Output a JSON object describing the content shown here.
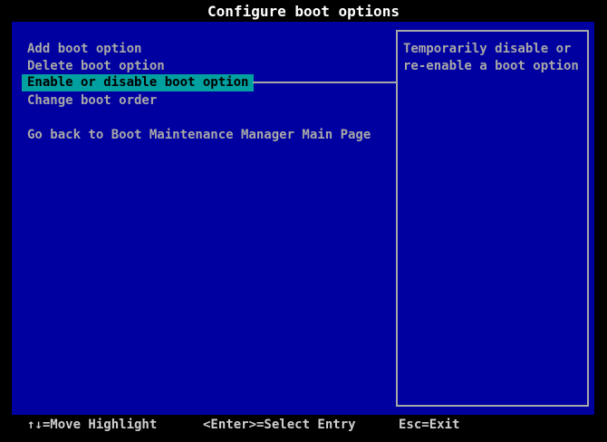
{
  "title": "Configure boot options",
  "colors": {
    "screen_background": "#000000",
    "panel_blue": "#0000A0",
    "menu_text_gray": "#A8A8A8",
    "highlight_background": "#00A0A0",
    "highlight_text": "#000000",
    "title_text": "#FFFFFF",
    "footer_text": "#D0D0D0",
    "help_border_gray": "#A8A8A8"
  },
  "menu": {
    "items": [
      {
        "label": "Add boot option",
        "selected": false
      },
      {
        "label": "Delete boot option",
        "selected": false
      },
      {
        "label": "Enable or disable boot option",
        "selected": true
      },
      {
        "label": "Change boot order",
        "selected": false
      }
    ],
    "back_item": "Go back to Boot Maintenance Manager Main Page"
  },
  "help_panel": {
    "lines": [
      "Temporarily disable or",
      "re-enable a boot option"
    ]
  },
  "footer": {
    "move_highlight": "↑↓=Move Highlight",
    "select_entry": "<Enter>=Select Entry",
    "exit": "Esc=Exit"
  }
}
